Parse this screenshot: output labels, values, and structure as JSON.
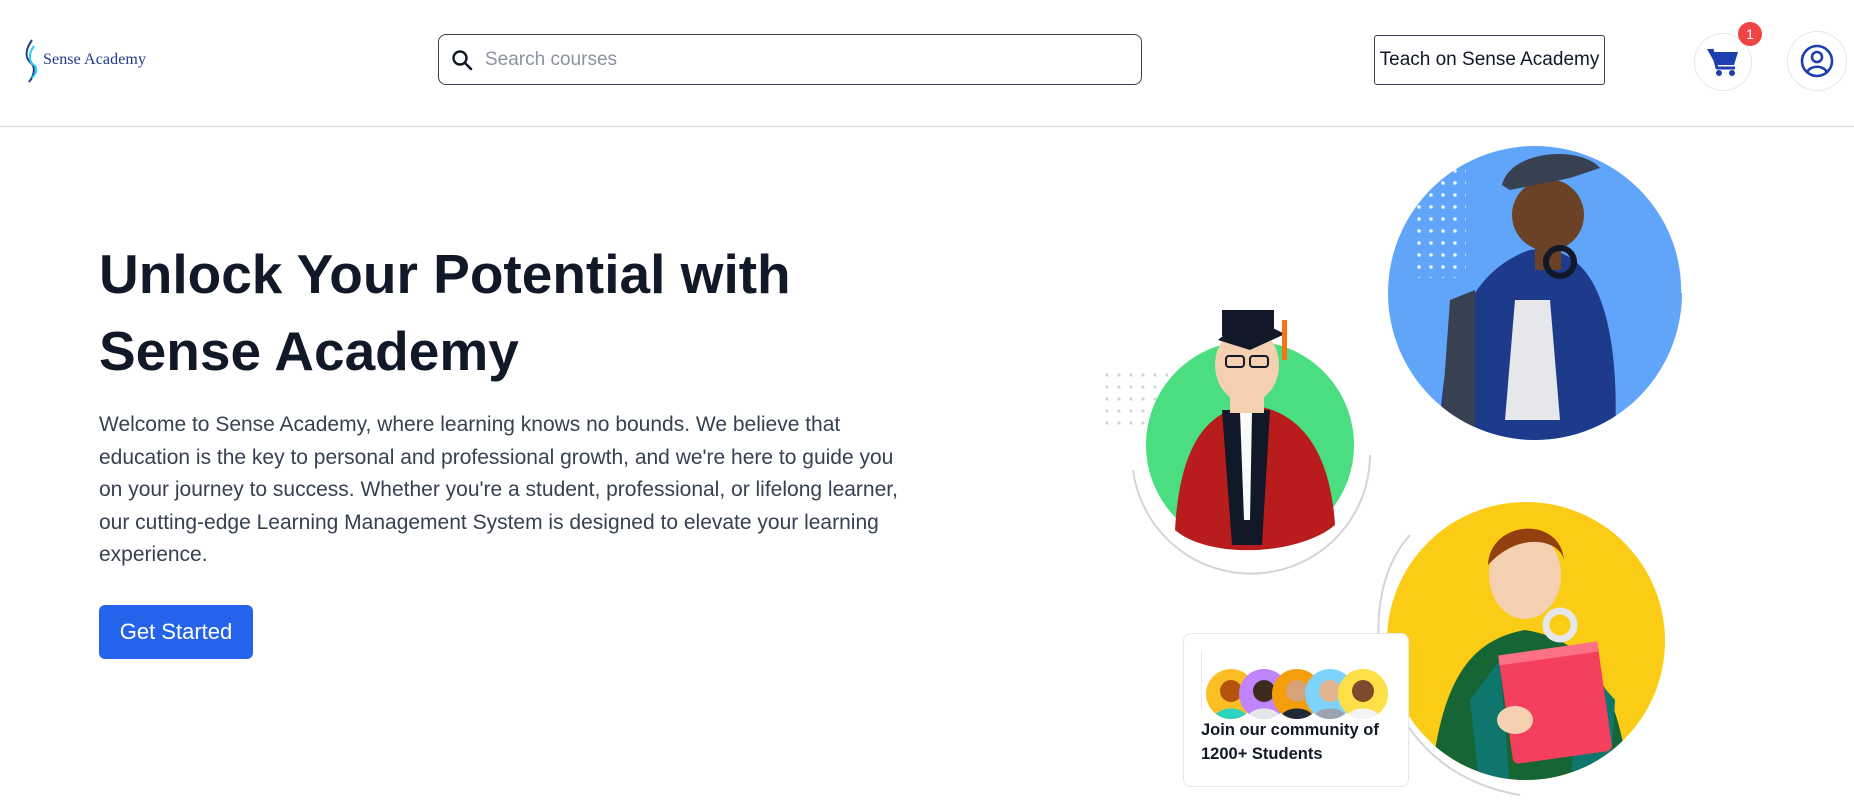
{
  "header": {
    "logo_text": "Sense Academy",
    "search": {
      "placeholder": "Search courses",
      "value": ""
    },
    "teach_label": "Teach on Sense Academy",
    "cart": {
      "icon": "cart-icon",
      "badge": "1"
    },
    "profile": {
      "icon": "user-circle-icon"
    }
  },
  "hero": {
    "title_line1": "Unlock Your Potential with",
    "title_line2": "Sense Academy",
    "description": "Welcome to Sense Academy, where learning knows no bounds. We believe that education is the key to personal and professional growth, and we're here to guide you on your journey to success. Whether you're a student, professional, or lifelong learner, our cutting-edge Learning Management System is designed to elevate your learning experience.",
    "cta_label": "Get Started"
  },
  "community": {
    "line1": "Join our community of",
    "line2": "1200+ Students"
  },
  "colors": {
    "primary": "#2563eb",
    "badge": "#ef4444",
    "circle_blue": "#60a5fa",
    "circle_green": "#4ade80",
    "circle_yellow": "#facc15",
    "title": "#111827"
  }
}
